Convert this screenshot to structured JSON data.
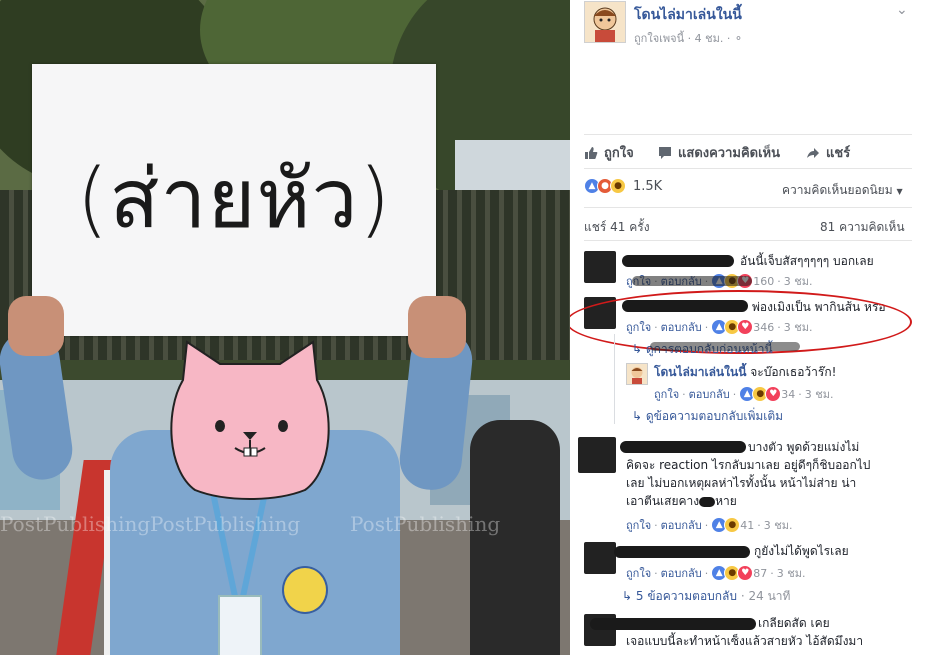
{
  "photo": {
    "sign_text": "(ส่ายหัว)",
    "watermark": "PostPublishing"
  },
  "post": {
    "page_name": "โดนไล่มาเล่นในนี้",
    "meta_liked": "ถูกใจเพจนี้",
    "time": "4 ชม.",
    "actions": {
      "like": "ถูกใจ",
      "comment": "แสดงความคิดเห็น",
      "share": "แชร์"
    },
    "reaction_count": "1.5K",
    "sort_label": "ความคิดเห็นยอดนิยม",
    "shares": "แชร์ 41 ครั้ง",
    "comments_count": "81 ความคิดเห็น"
  },
  "comments": [
    {
      "text": "อันนี้เจ็บสัสๆๆๆๆๆ บอกเลย",
      "like": "ถูกใจ",
      "reply": "ตอบกลับ",
      "count": "160",
      "time": "3 ชม."
    },
    {
      "text": "พ่องเมิงเป็น พากินส้น หรอ",
      "like": "ถูกใจ",
      "reply": "ตอบกลับ",
      "count": "346",
      "time": "3 ชม.",
      "prev_replies": "ดูการตอบกลับก่อนหน้านี้"
    },
    {
      "name": "โดนไล่มาเล่นในนี้",
      "text": "จะบ๊อกเธอว้าร๊ก!",
      "like": "ถูกใจ",
      "reply": "ตอบกลับ",
      "count": "34",
      "time": "3 ชม.",
      "more": "ดูข้อความตอบกลับเพิ่มเติม"
    },
    {
      "lines": [
        "บางตัว พูดด้วยแม่งไม่",
        "คิดจะ reaction ไรกลับมาเลย อยู่ดีๆก็ชิบออกไป",
        "เลย ไม่บอกเหตุผลห่าไรทั้งนั้น หน้าไม่ส่าย น่า",
        "เอาตีนเสยคาง",
        "หาย"
      ],
      "like": "ถูกใจ",
      "reply": "ตอบกลับ",
      "count": "41",
      "time": "3 ชม."
    },
    {
      "text": "กูยังไม่ได้พูดไรเลย",
      "like": "ถูกใจ",
      "reply": "ตอบกลับ",
      "count": "87",
      "time": "3 ชม.",
      "replies": "5 ข้อความตอบกลับ",
      "replies_time": "24 นาที"
    },
    {
      "lines": [
        "เกลียดสัด เคย",
        "เจอแบบนี้ละทำหน้าเซ็งแล้วสายหัว ไอ้สัดมึงมา"
      ]
    }
  ],
  "colors": {
    "link": "#365899",
    "circle": "#d11a1a",
    "meta": "#90949c"
  }
}
